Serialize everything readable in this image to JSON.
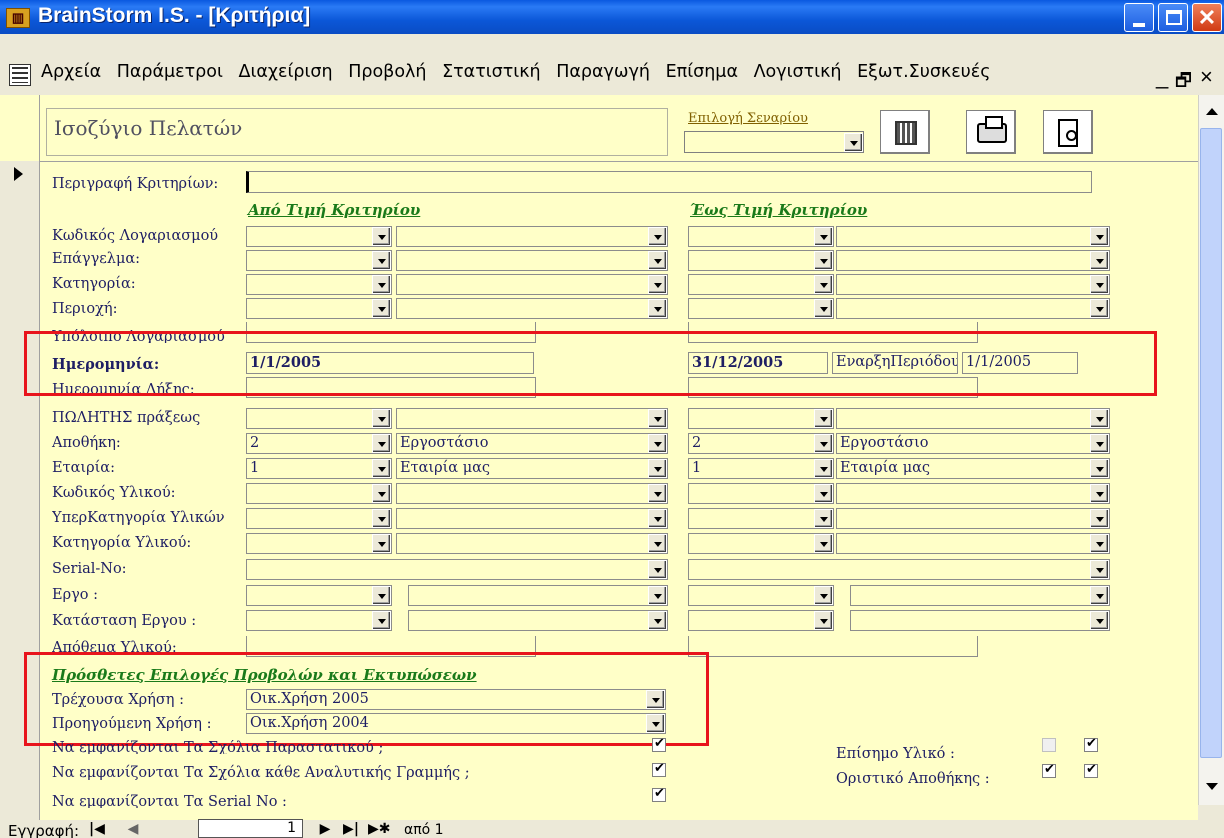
{
  "window": {
    "title": "BrainStorm I.S. - [Κριτήρια]",
    "app_icon": "app-logo-icon"
  },
  "menu": {
    "items": [
      "Αρχεία",
      "Παράμετροι",
      "Διαχείριση",
      "Προβολή",
      "Στατιστική",
      "Παραγωγή",
      "Επίσημα",
      "Λογιστική",
      "Εξωτ.Συσκευές"
    ],
    "mdi_min": "_",
    "mdi_restore": "🗗",
    "mdi_close": "×"
  },
  "header": {
    "title": "Ισοζύγιο Πελατών",
    "scenario_label": "Επιλογή Σεναρίου",
    "scenario_value": ""
  },
  "criteria_label": "Περιγραφή Κριτηρίων:",
  "columns": {
    "from": "Από Τιμή Κριτηρίου",
    "to": "Έως Τιμή Κριτηρίου"
  },
  "rows": {
    "account": "Κωδικός Λογαριασμού",
    "profession": "Επάγγελμα:",
    "category": "Κατηγορία:",
    "region": "Περιοχή:",
    "balance": "Υπόλοιπο Λογαριασμού",
    "date": "Ημερομηνία:",
    "due_date": "Ημερομηνία Λήξης:",
    "salesman": "ΠΩΛΗΤΗΣ πράξεως",
    "warehouse": "Αποθήκη:",
    "company": "Εταιρία:",
    "item_code": "Κωδικός Υλικού:",
    "item_supercat": "ΥπερΚατηγορία Υλικών",
    "item_cat": "Κατηγορία Υλικού:",
    "serial": "Serial-No:",
    "project": "Εργο :",
    "project_status": "Κατάσταση Εργου :",
    "stock": "Απόθεμα Υλικού:"
  },
  "values": {
    "date_from": "1/1/2005",
    "date_to": "31/12/2005",
    "period_start_label": "ΕναρξηΠεριόδου:",
    "period_start": "1/1/2005",
    "warehouse_from_code": "2",
    "warehouse_from_name": "Εργοστάσιο",
    "warehouse_to_code": "2",
    "warehouse_to_name": "Εργοστάσιο",
    "company_from_code": "1",
    "company_from_name": "Εταιρία μας",
    "company_to_code": "1",
    "company_to_name": "Εταιρία μας"
  },
  "extra": {
    "title": "Πρόσθετες Επιλογές Προβολών και Εκτυπώσεων",
    "current_year_label": "Τρέχουσα Χρήση :",
    "current_year": "Οικ.Χρήση 2005",
    "prev_year_label": "Προηγούμενη Χρήση :",
    "prev_year": "Οικ.Χρήση 2004",
    "show_doc_comments": "Να εμφανίζονται Τα Σχόλια Παραστατικού ;",
    "show_line_comments": "Να εμφανίζονται Τα Σχόλια κάθε Αναλυτικής Γραμμής ;",
    "show_serials": "Να εμφανίζονται Τα Serial No :",
    "official_item": "Επίσημο Υλικό :",
    "final_warehouse": "Οριστικό Αποθήκης :"
  },
  "nav": {
    "label": "Εγγραφή:",
    "current": "1",
    "of": "από 1"
  },
  "colors": {
    "form_bg": "#ffffc8",
    "label": "#1e1e64",
    "heading": "#1a7a1a",
    "highlight": "#e8141c",
    "titlebar": "#0a58e0"
  }
}
